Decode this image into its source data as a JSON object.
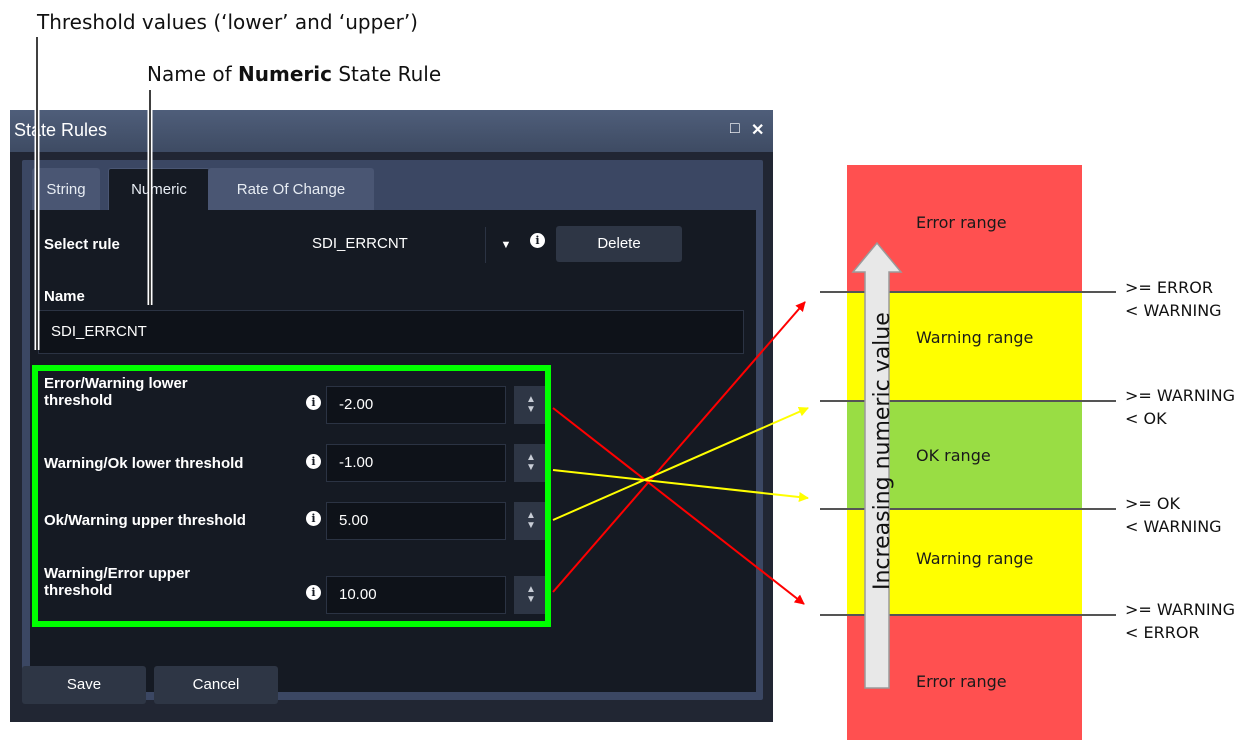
{
  "callouts": {
    "threshold": "Threshold values (‘lower’ and ‘upper’)",
    "name_prefix": "Name of ",
    "name_bold": "Numeric",
    "name_suffix": " State Rule"
  },
  "dialog": {
    "title": "State Rules",
    "maximize_glyph": "□",
    "close_glyph": "✕",
    "tabs": [
      {
        "label": "String"
      },
      {
        "label": "Numeric"
      },
      {
        "label": "Rate Of Change"
      }
    ],
    "active_tab": "Numeric",
    "select_rule": {
      "label": "Select rule",
      "value": "SDI_ERRCNT",
      "delete_label": "Delete"
    },
    "name": {
      "label": "Name",
      "value": "SDI_ERRCNT"
    },
    "thresholds": [
      {
        "label": "Error/Warning lower threshold",
        "value": "-2.00"
      },
      {
        "label": "Warning/Ok lower threshold",
        "value": "-1.00"
      },
      {
        "label": "Ok/Warning upper threshold",
        "value": "5.00"
      },
      {
        "label": "Warning/Error upper threshold",
        "value": "10.00"
      }
    ],
    "save_label": "Save",
    "cancel_label": "Cancel",
    "info_glyph": "i"
  },
  "ranges": {
    "bands": [
      {
        "label": "Error range",
        "color": "#ff5050"
      },
      {
        "label": "Warning range",
        "color": "#ffff00"
      },
      {
        "label": "OK range",
        "color": "#99dd44"
      },
      {
        "label": "Warning range",
        "color": "#ffff00"
      },
      {
        "label": "Error range",
        "color": "#ff5050"
      }
    ],
    "axis_label": "Increasing numeric value",
    "boundaries": [
      {
        "line1": ">= ERROR",
        "line2": "< WARNING"
      },
      {
        "line1": ">= WARNING",
        "line2": "< OK"
      },
      {
        "line1": ">= OK",
        "line2": "< WARNING"
      },
      {
        "line1": ">= WARNING",
        "line2": "< ERROR"
      }
    ]
  },
  "colors": {
    "dialog_bg": "#212633",
    "titlebar": "#4a5673",
    "highlight_box": "#00ff00",
    "error_arrow": "#ff0000",
    "warning_arrow": "#ffff00"
  }
}
